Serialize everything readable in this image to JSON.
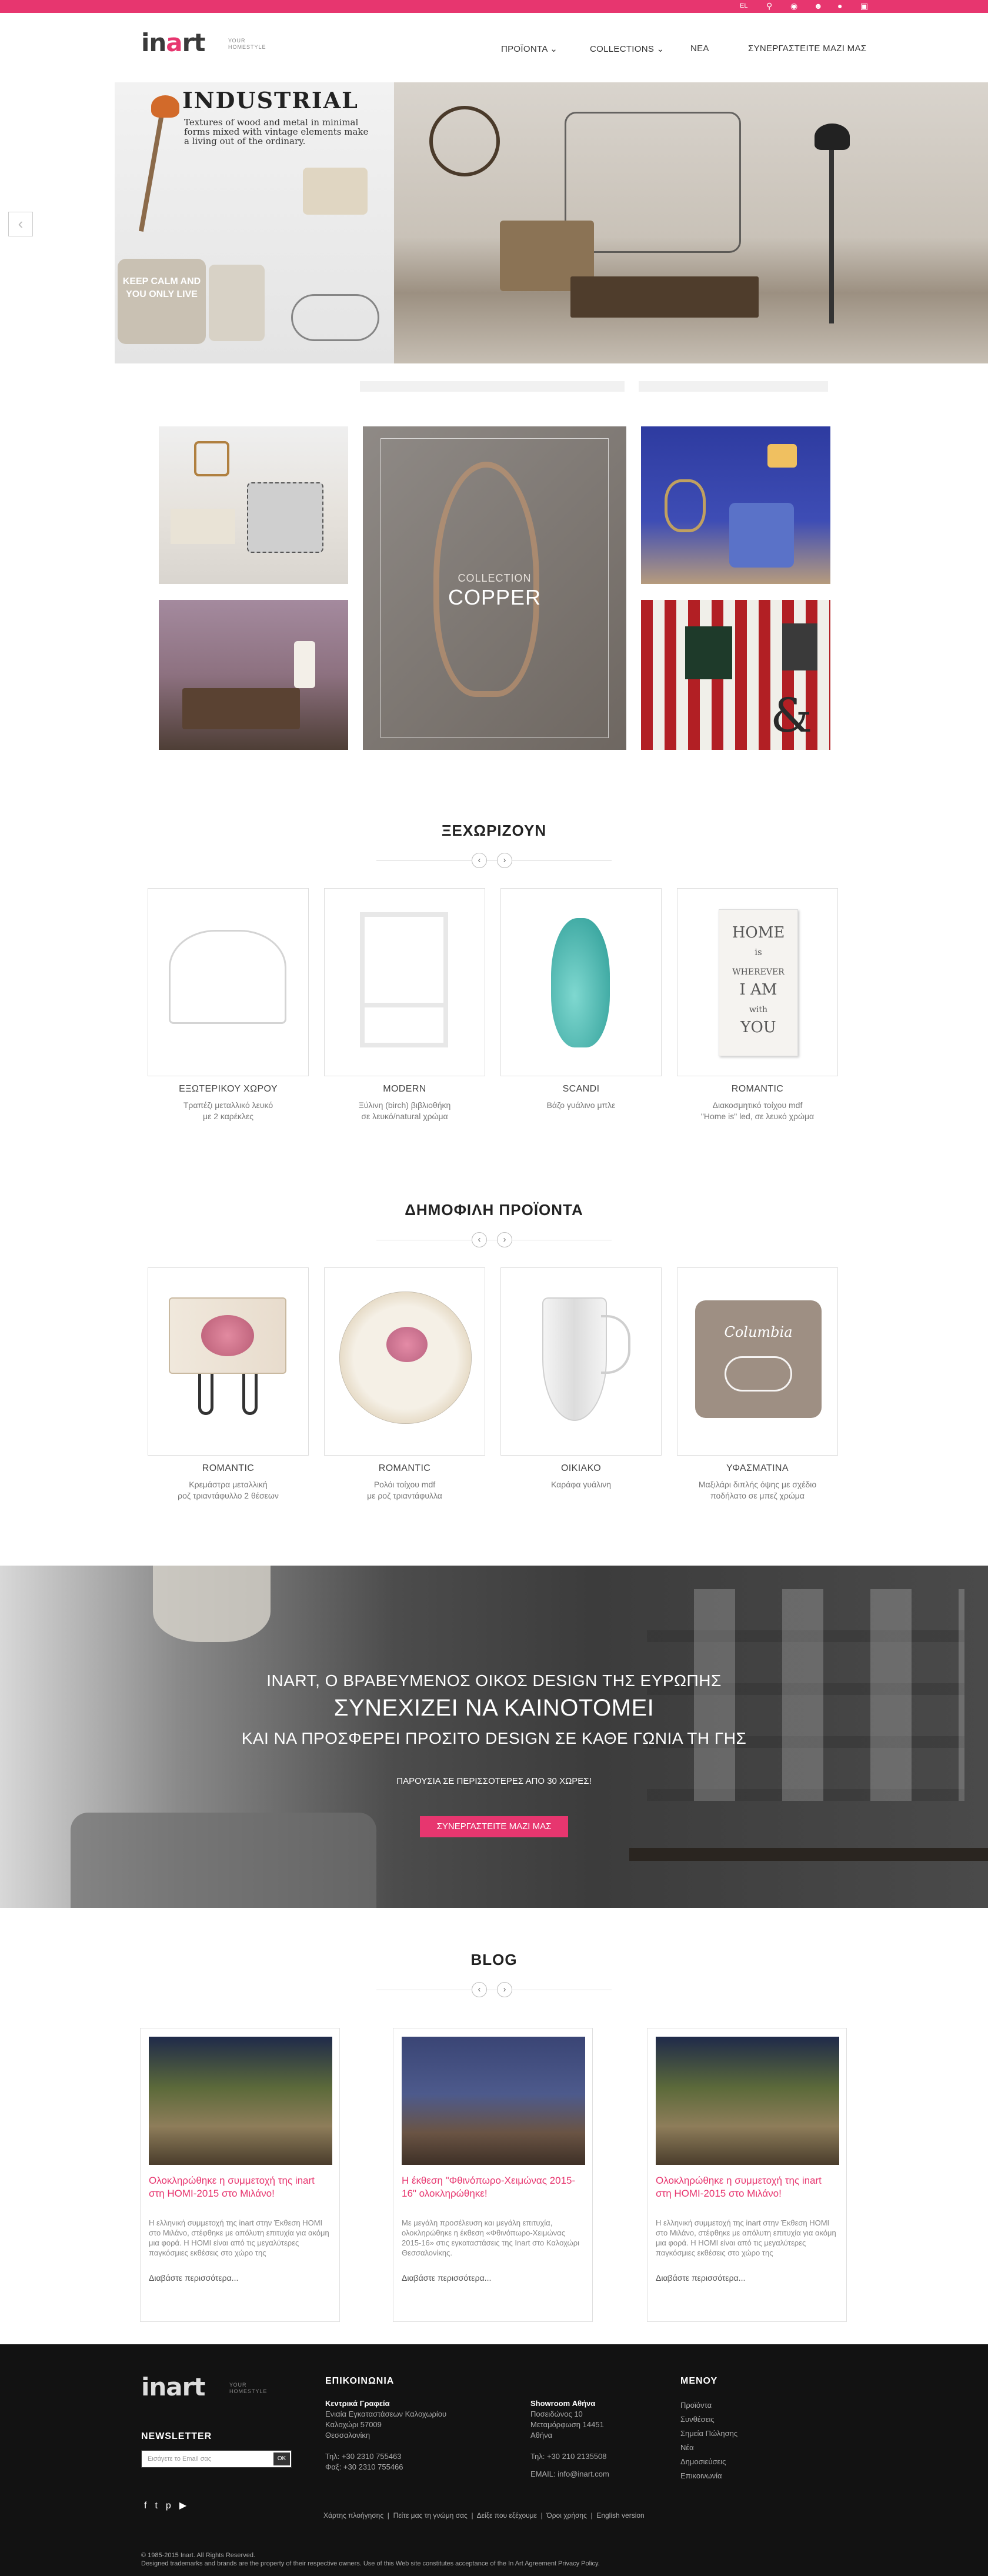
{
  "header": {
    "logo": "inart",
    "logo_sub": "ΥΟUR HOMESTYLE",
    "tagline": "ΥΟUR HOMESTYLE",
    "nav": [
      "ΠΡΟΪΟΝΤΑ",
      "COLLECTIONS",
      "ΝΕΑ",
      "ΣΥΝΕΡΓΑΣΤΕΙΤΕ ΜΑΖΙ ΜΑΣ"
    ],
    "lang": "EL"
  },
  "slider": {
    "heading": "INDUSTRIAL",
    "text": "Textures of wood and metal in minimal forms mixed with vintage elements make a living out of the ordinary.",
    "pillow": "KEEP CALM AND YOU ONLY LIVE",
    "prev": "‹",
    "next": "›"
  },
  "collections": {
    "label": "COLLECTION",
    "name": "COPPER"
  },
  "featured": {
    "title": "ΞΕΧΩΡΙΖΟΥΝ",
    "items": [
      {
        "category": "ΕΞΩΤΕΡΙΚΟΥ ΧΩΡΟΥ",
        "desc1": "Τραπέζι μεταλλικό λευκό",
        "desc2": "με 2 καρέκλες"
      },
      {
        "category": "MODERN",
        "desc1": "Ξύλινη (birch) βιβλιοθήκη",
        "desc2": "σε λευκό/natural χρώμα"
      },
      {
        "category": "SCANDI",
        "desc1": "Βάζο γυάλινο μπλε",
        "desc2": ""
      },
      {
        "category": "ROMANTIC",
        "desc1": "Διακοσμητικό τοίχου mdf",
        "desc2": "\"Home is\" led, σε λευκό χρώμα"
      }
    ]
  },
  "popular": {
    "title": "ΔΗΜΟΦΙΛΗ ΠΡΟΪΟΝΤΑ",
    "items": [
      {
        "category": "ROMANTIC",
        "desc1": "Κρεμάστρα μεταλλική",
        "desc2": "ροζ τριαντάφυλλο 2 θέσεων"
      },
      {
        "category": "ROMANTIC",
        "desc1": "Ρολόι τοίχου mdf",
        "desc2": "με ροζ τριαντάφυλλα"
      },
      {
        "category": "ΟΙΚΙΑΚΟ",
        "desc1": "Καράφα γυάλινη",
        "desc2": ""
      },
      {
        "category": "ΥΦΑΣΜΑΤΙΝΑ",
        "desc1": "Μαξιλάρι διπλής όψης με σχέδιο",
        "desc2": "ποδήλατο σε μπεζ χρώμα"
      }
    ]
  },
  "banner": {
    "line1": "INART, Ο ΒΡΑΒΕΥΜΕΝΟΣ ΟΙΚΟΣ DESIGN ΤΗΣ ΕΥΡΩΠΗΣ",
    "line2": "ΣΥΝΕΧΙΖΕΙ ΝΑ ΚΑΙΝΟΤΟΜΕΙ",
    "line3": "ΚΑΙ ΝΑ ΠΡΟΣΦΕΡΕΙ ΠΡΟΣΙΤΟ DESIGN ΣΕ ΚΑΘΕ ΓΩΝΙΑ ΤΗ ΓΗΣ",
    "presence": "ΠΑΡΟΥΣΙΑ ΣΕ ΠΕΡΙΣΣΟΤΕΡΕΣ ΑΠΟ 30 ΧΩΡΕΣ!",
    "button": "ΣΥΝΕΡΓΑΣΤΕΙΤΕ ΜΑΖΙ ΜΑΣ"
  },
  "blog": {
    "title": "BLOG",
    "posts": [
      {
        "title": "Ολοκληρώθηκε η συμμετοχή της inart στη HOMI-2015 στο Μιλάνο!",
        "excerpt": "Η ελληνική συμμετοχή της inart στην Έκθεση HOMI στο Μιλάνο, στέφθηκε με απόλυτη επιτυχία για ακόμη μια φορά. Η HOMI είναι από τις μεγαλύτερες παγκόσμιες εκθέσεις στο χώρο της",
        "more": "Διαβάστε περισσότερα..."
      },
      {
        "title": "Η έκθεση \"Φθινόπωρο-Χειμώνας 2015-16\" ολοκληρώθηκε!",
        "excerpt": "Με μεγάλη προσέλευση και μεγάλη επιτυχία, ολοκληρώθηκε η έκθεση «Φθινόπωρο-Χειμώνας 2015-16» στις εγκαταστάσεις της Inart στο Καλοχώρι Θεσσαλονίκης.",
        "more": "Διαβάστε περισσότερα..."
      },
      {
        "title": "Ολοκληρώθηκε η συμμετοχή της inart στη HOMI-2015 στο Μιλάνο!",
        "excerpt": "Η ελληνική συμμετοχή της inart στην Έκθεση HOMI στο Μιλάνο, στέφθηκε με απόλυτη επιτυχία για ακόμη μια φορά. Η HOMI είναι από τις μεγαλύτερες παγκόσμιες εκθέσεις στο χώρο της",
        "more": "Διαβάστε περισσότερα..."
      }
    ]
  },
  "footer": {
    "logo": "inart",
    "tagline": "ΥΟUR HOMESTYLE",
    "contact_title": "ΕΠΙΚΟΙΝΩΝΙΑ",
    "hq_title": "Κεντρικά Γραφεία",
    "hq_lines": [
      "Ενιαία Εγκαταστάσεων Καλοχωρίου",
      "Καλοχώρι 57009",
      "Θεσσαλονίκη"
    ],
    "hq_tel": "Τηλ: +30 2310 755463",
    "hq_fax": "Φαξ: +30 2310 755466",
    "showroom_title": "Showroom Αθήνα",
    "showroom_lines": [
      "Ποσειδώνος 10",
      "Μεταμόρφωση 14451",
      "Αθήνα"
    ],
    "showroom_tel": "Τηλ: +30 210 2135508",
    "email": "EMAIL: info@inart.com",
    "menu_title": "ΜΕΝΟΥ",
    "menu": [
      "Προϊόντα",
      "Συνθέσεις",
      "Σημεία Πώλησης",
      "Νέα",
      "Δημοσιεύσεις",
      "Επικοινωνία"
    ],
    "newsletter_title": "NEWSLETTER",
    "newsletter_placeholder": "Εισάγετε το Email σας",
    "newsletter_button": "OK",
    "links": [
      "Χάρτης πλοήγησης",
      "Πείτε μας τη γνώμη σας",
      "Δείξε που εξέχουμε",
      "Όροι χρήσης",
      "English version"
    ],
    "copyright": "© 1985-2015 Inart. All Rights Reserved.",
    "legal": "Designed trademarks and brands are the property of their respective owners. Use of this Web site constitutes acceptance of the In Art Agreement Privacy Policy."
  }
}
